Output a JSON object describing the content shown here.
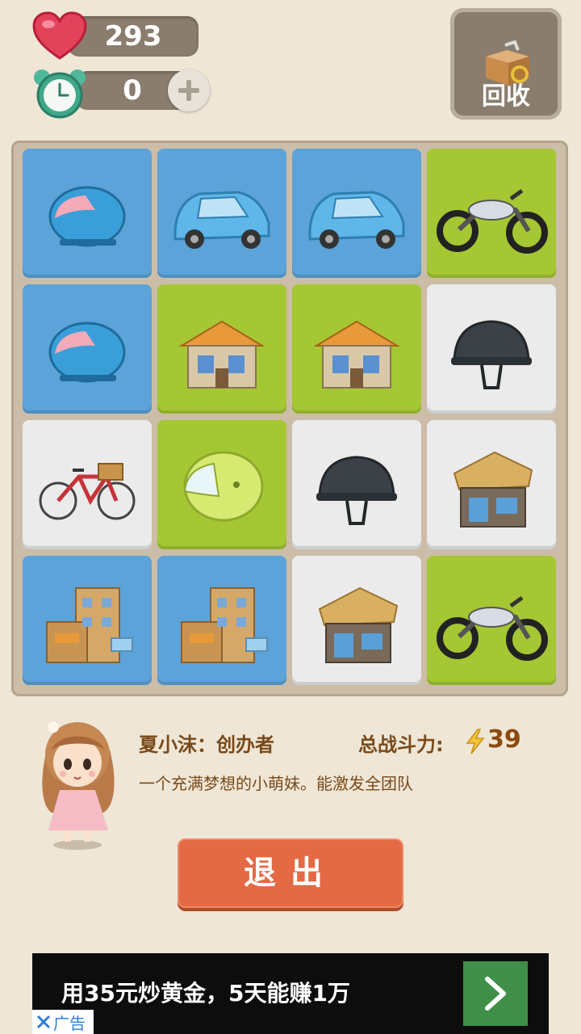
{
  "hud": {
    "hearts": "293",
    "time_bonus": "0",
    "recycle_label": "回收"
  },
  "board": {
    "rows": [
      [
        {
          "color": "blue",
          "item": "blue-motorcycle-helmet"
        },
        {
          "color": "blue",
          "item": "blue-car"
        },
        {
          "color": "blue",
          "item": "blue-car"
        },
        {
          "color": "green",
          "item": "motorcycle"
        }
      ],
      [
        {
          "color": "blue",
          "item": "blue-motorcycle-helmet"
        },
        {
          "color": "green",
          "item": "house"
        },
        {
          "color": "green",
          "item": "house"
        },
        {
          "color": "white",
          "item": "black-helmet"
        }
      ],
      [
        {
          "color": "white",
          "item": "red-bicycle"
        },
        {
          "color": "green",
          "item": "yellow-helmet"
        },
        {
          "color": "white",
          "item": "black-helmet"
        },
        {
          "color": "white",
          "item": "shop"
        }
      ],
      [
        {
          "color": "blue",
          "item": "building"
        },
        {
          "color": "blue",
          "item": "building"
        },
        {
          "color": "white",
          "item": "shop"
        },
        {
          "color": "green",
          "item": "motorcycle"
        }
      ]
    ]
  },
  "character": {
    "name_title": "夏小沫：创办者",
    "power_label": "总战斗力:",
    "power_value": "39",
    "description": "一个充满梦想的小萌妹。能激发全团队"
  },
  "exit_label": "退出",
  "ad": {
    "text": "用35元炒黄金，5天能赚1万",
    "label": "广告"
  },
  "colors": {
    "blue": "#5ba3d9",
    "green": "#a5c733",
    "white": "#ebebeb",
    "exit_button": "#e36a45"
  }
}
